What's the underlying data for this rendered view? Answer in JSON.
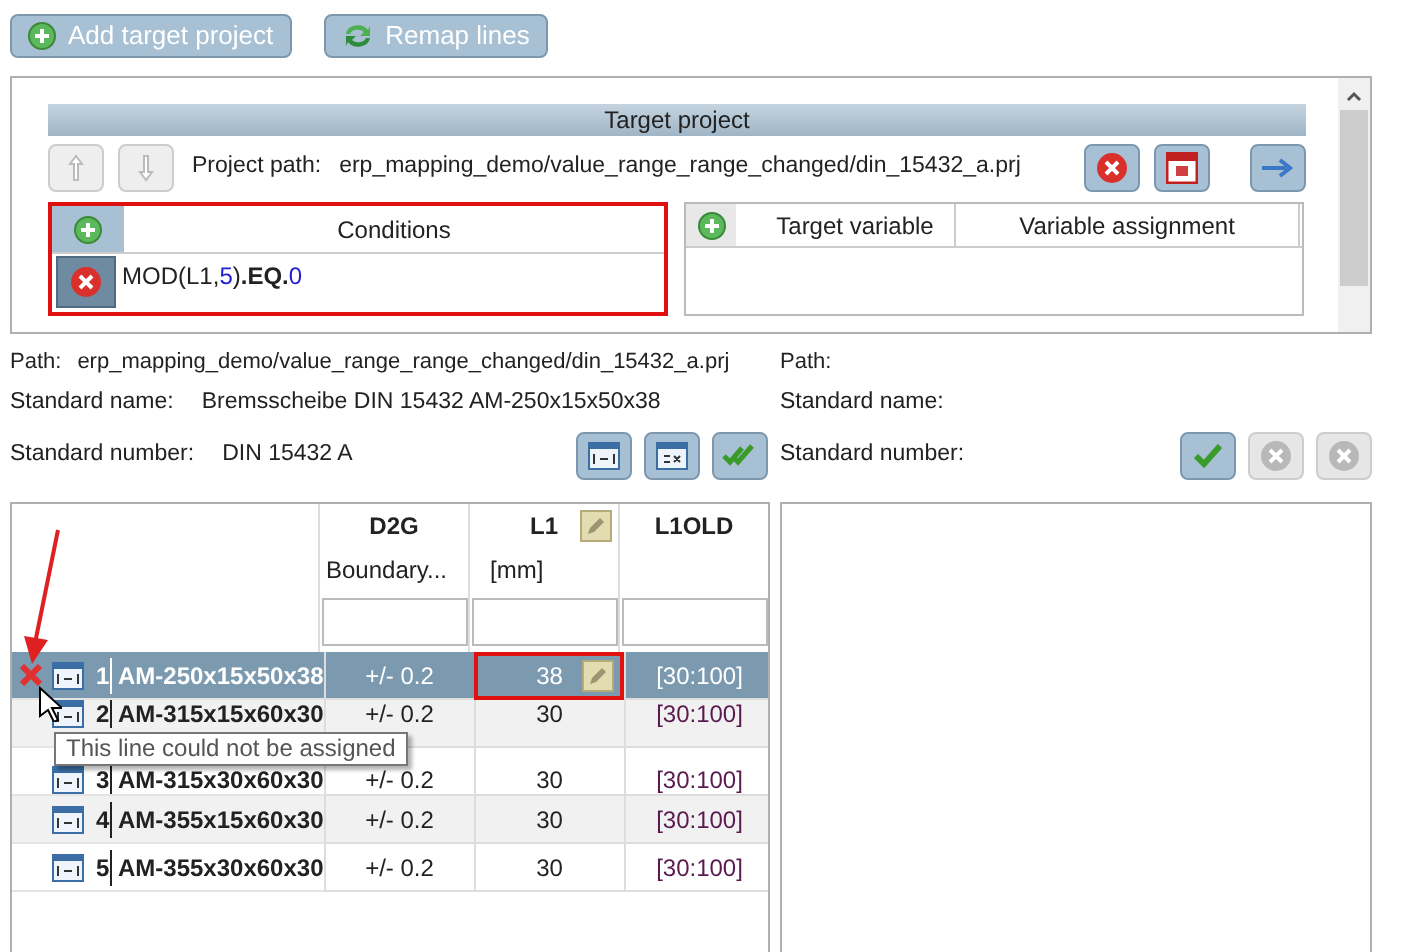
{
  "toolbar": [
    {
      "label": "Add target project",
      "kind": "add"
    },
    {
      "label": "Remap lines",
      "kind": "remap"
    }
  ],
  "target_project": {
    "title": "Target project",
    "path_label": "Project path:",
    "path": "erp_mapping_demo/value_range_range_changed/din_15432_a.prj",
    "conditions": {
      "header": "Conditions",
      "highlighted": true,
      "rows": [
        {
          "tokens": [
            {
              "text": "MOD(L1,",
              "kind": "plain"
            },
            {
              "text": "5",
              "kind": "number"
            },
            {
              "text": ")",
              "kind": "plain"
            },
            {
              "text": ".EQ.",
              "kind": "operator"
            },
            {
              "text": "0",
              "kind": "number"
            }
          ]
        }
      ]
    },
    "assignments": {
      "columns": [
        "Target variable",
        "Variable assignment"
      ]
    }
  },
  "source": {
    "path_label": "Path:",
    "path": "erp_mapping_demo/value_range_range_changed/din_15432_a.prj",
    "name_label": "Standard name:",
    "name": "Bremsscheibe DIN 15432 AM-250x15x50x38",
    "number_label": "Standard number:",
    "number": "DIN 15432 A"
  },
  "target": {
    "path_label": "Path:",
    "name_label": "Standard name:",
    "number_label": "Standard number:"
  },
  "grid": {
    "columns": [
      {
        "name": "D2G",
        "unit": "Boundary...",
        "editable": false
      },
      {
        "name": "L1",
        "unit": "[mm]",
        "editable": true
      },
      {
        "name": "L1OLD",
        "editable": false
      }
    ],
    "rows": [
      {
        "index": "1",
        "name": "AM-250x15x50x38",
        "selected": true,
        "error": true,
        "cells": [
          "+/- 0.2",
          "38",
          "[30:100]"
        ],
        "highlighted_cells": [
          false,
          true,
          false
        ]
      },
      {
        "index": "2",
        "name": "AM-315x15x60x30",
        "selected": false,
        "error": false,
        "cells": [
          "+/- 0.2",
          "30",
          "[30:100]"
        ]
      },
      {
        "index": "3",
        "name": "AM-315x30x60x30",
        "selected": false,
        "error": false,
        "cells": [
          "+/- 0.2",
          "30",
          "[30:100]"
        ]
      },
      {
        "index": "4",
        "name": "AM-355x15x60x30",
        "selected": false,
        "error": false,
        "cells": [
          "+/- 0.2",
          "30",
          "[30:100]"
        ]
      },
      {
        "index": "5",
        "name": "AM-355x30x60x30",
        "selected": false,
        "error": false,
        "cells": [
          "+/- 0.2",
          "30",
          "[30:100]"
        ]
      }
    ],
    "tooltip": "This line could not be assigned",
    "annotation_arrow": true
  }
}
